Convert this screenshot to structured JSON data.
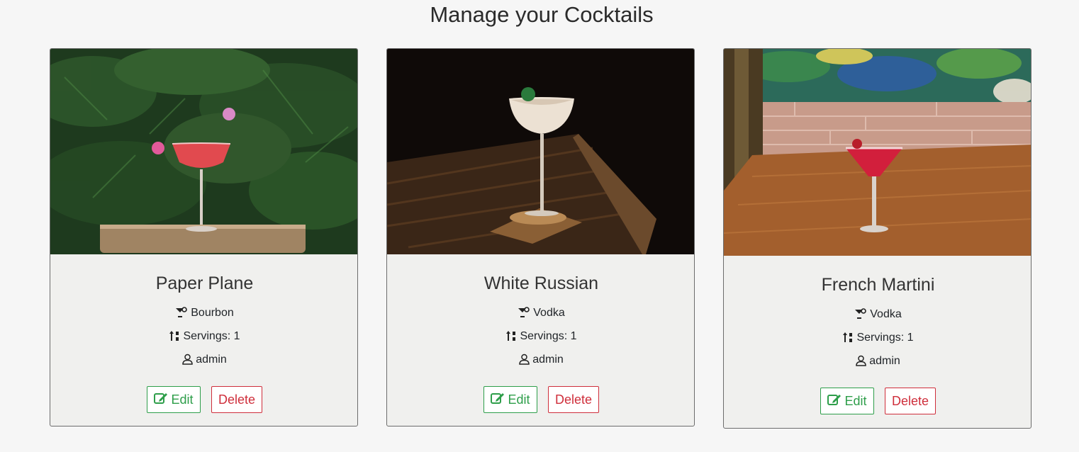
{
  "page": {
    "title": "Manage your Cocktails"
  },
  "cards": [
    {
      "name": "Paper Plane",
      "spirit": "Bourbon",
      "servings": "Servings: 1",
      "author": "admin",
      "edit_label": "Edit",
      "delete_label": "Delete"
    },
    {
      "name": "White Russian",
      "spirit": "Vodka",
      "servings": "Servings: 1",
      "author": "admin",
      "edit_label": "Edit",
      "delete_label": "Delete"
    },
    {
      "name": "French Martini",
      "spirit": "Vodka",
      "servings": "Servings: 1",
      "author": "admin",
      "edit_label": "Edit",
      "delete_label": "Delete"
    }
  ],
  "colors": {
    "edit": "#2e9e4a",
    "delete": "#cf2e3b",
    "background": "#f6f6f6",
    "card": "#f0f0ee"
  },
  "icons": {
    "spirit": "cocktail-icon",
    "servings": "sort-icon",
    "author": "user-icon",
    "edit": "edit-icon"
  }
}
